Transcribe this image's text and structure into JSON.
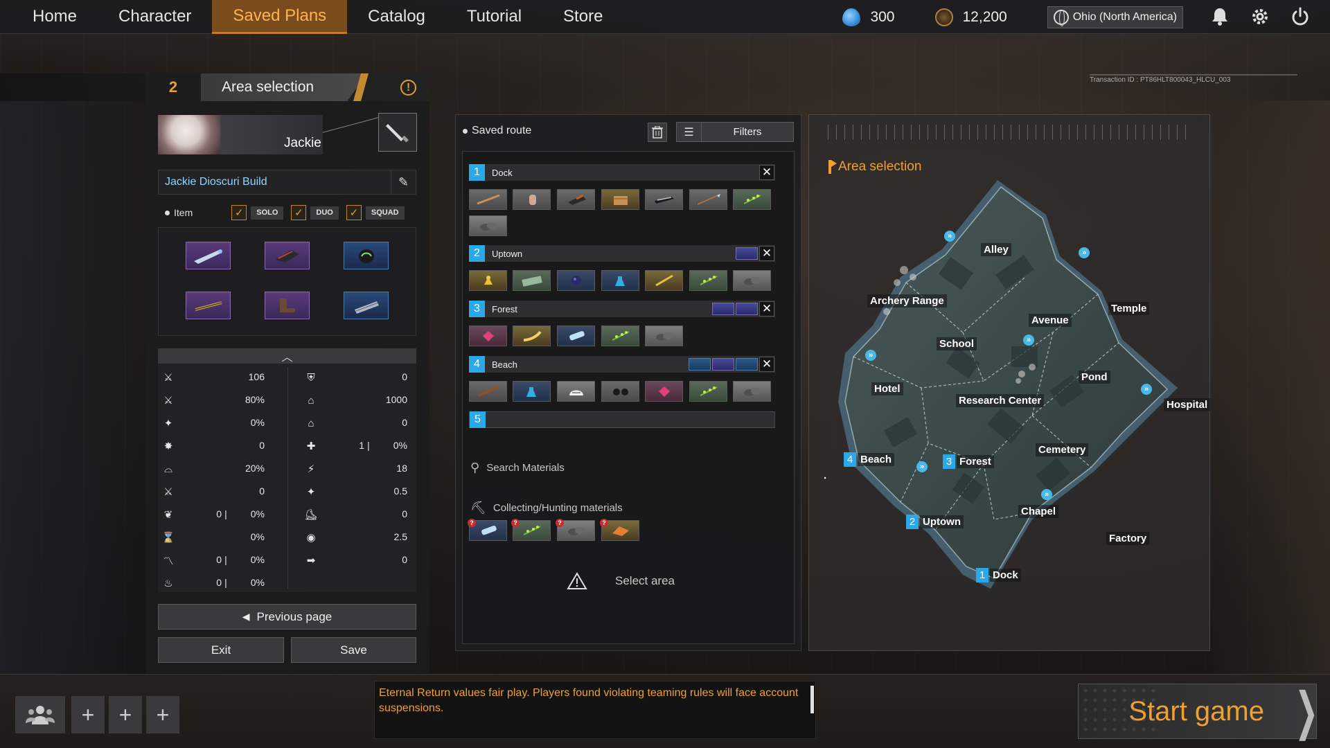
{
  "nav": {
    "tabs": [
      "Home",
      "Character",
      "Saved Plans",
      "Catalog",
      "Tutorial",
      "Store"
    ],
    "active_tab": "Saved Plans",
    "currency_water": "300",
    "currency_coin": "12,200",
    "region": "Ohio (North America)",
    "icons": [
      "bell-icon",
      "gear-icon",
      "power-icon"
    ]
  },
  "step": {
    "number": "2",
    "title": "Area selection",
    "transaction_id": "Transaction ID : PT86HLT800043_HLCU_003"
  },
  "character": {
    "name": "Jackie",
    "build_name": "Jackie Dioscuri Build",
    "item_label": "Item",
    "modes": [
      "SOLO",
      "DUO",
      "SQUAD"
    ],
    "items": [
      {
        "name": "sword-icon",
        "rarity": "purple"
      },
      {
        "name": "armor-icon",
        "rarity": "purple"
      },
      {
        "name": "helmet-icon",
        "rarity": "blue"
      },
      {
        "name": "bracer-icon",
        "rarity": "purple"
      },
      {
        "name": "boots-icon",
        "rarity": "purple"
      },
      {
        "name": "accessory-icon",
        "rarity": "blue"
      }
    ]
  },
  "stats": {
    "left": [
      {
        "icon": "attack-icon",
        "value": "106"
      },
      {
        "icon": "attack-speed-icon",
        "value": "80%"
      },
      {
        "icon": "crit-icon",
        "value": "0%"
      },
      {
        "icon": "skill-amp-icon",
        "value": "0"
      },
      {
        "icon": "lifesteal-icon",
        "value": "20%"
      },
      {
        "icon": "cooldown-icon",
        "value": "0"
      },
      {
        "icon": "extra-dmg-icon",
        "value1": "0",
        "value2": "0%"
      },
      {
        "icon": "hourglass-icon",
        "value": "0%"
      },
      {
        "icon": "move-icon",
        "value1": "0",
        "value2": "0%"
      },
      {
        "icon": "vision-dmg-icon",
        "value1": "0",
        "value2": "0%"
      }
    ],
    "right": [
      {
        "icon": "defense-icon",
        "value": "0"
      },
      {
        "icon": "hp-icon",
        "value": "1000"
      },
      {
        "icon": "sp-icon",
        "value": "0"
      },
      {
        "icon": "regen-icon",
        "value1": "1",
        "value2": "0%"
      },
      {
        "icon": "sp-regen-icon",
        "value": "18"
      },
      {
        "icon": "move-speed-icon",
        "value": "0.5"
      },
      {
        "icon": "out-combat-icon",
        "value": "0"
      },
      {
        "icon": "vision-icon",
        "value": "2.5"
      },
      {
        "icon": "range-icon",
        "value": "0"
      }
    ]
  },
  "buttons": {
    "previous_page": "Previous page",
    "exit": "Exit",
    "save": "Save"
  },
  "route": {
    "title": "Saved route",
    "filters_label": "Filters",
    "areas": [
      {
        "num": "1",
        "name": "Dock",
        "materials": [
          "stick",
          "glove",
          "whetstone",
          "box",
          "dagger",
          "spear",
          "herb",
          "stone"
        ],
        "extra": 0
      },
      {
        "num": "2",
        "name": "Uptown",
        "materials": [
          "flower",
          "fabric",
          "orb",
          "bottle",
          "pen",
          "herb",
          "stone"
        ],
        "extra": 1
      },
      {
        "num": "3",
        "name": "Forest",
        "materials": [
          "gem",
          "banana",
          "tube",
          "herb",
          "stone"
        ],
        "extra": 2
      },
      {
        "num": "4",
        "name": "Beach",
        "materials": [
          "bat",
          "bottle",
          "helmet",
          "binoculars",
          "gem",
          "herb",
          "stone"
        ],
        "extra": 3
      },
      {
        "num": "5",
        "name": "",
        "materials": [],
        "extra": 0
      }
    ],
    "search_label": "Search Materials",
    "collecting_label": "Collecting/Hunting materials",
    "collecting_items": [
      "tube",
      "herb",
      "stone",
      "leaf"
    ],
    "select_area_label": "Select area"
  },
  "map": {
    "title": "Area selection",
    "labels": [
      "Alley",
      "Archery Range",
      "Temple",
      "Avenue",
      "School",
      "Pond",
      "Hotel",
      "Research Center",
      "Hospital",
      "Cemetery",
      "Chapel",
      "Factory"
    ],
    "numbered": [
      {
        "num": "4",
        "name": "Beach"
      },
      {
        "num": "3",
        "name": "Forest"
      },
      {
        "num": "2",
        "name": "Uptown"
      },
      {
        "num": "1",
        "name": "Dock"
      }
    ]
  },
  "bottom": {
    "notice": "Eternal Return values fair play. Players found violating teaming rules will face account suspensions.",
    "start_label": "Start game"
  }
}
